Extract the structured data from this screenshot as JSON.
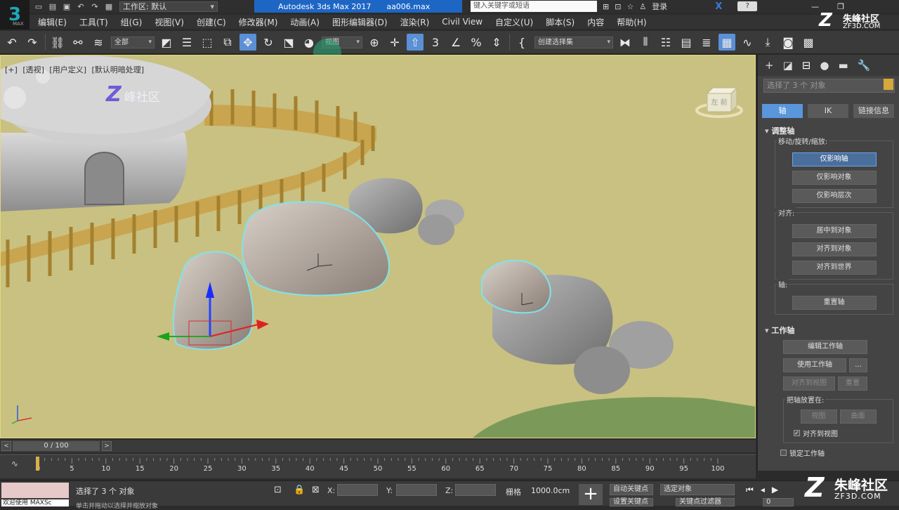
{
  "title_bar": {
    "workspace_label": "工作区: 默认",
    "app_title": "Autodesk 3ds Max 2017",
    "file_name": "aa006.max",
    "search_placeholder": "键入关键字或短语",
    "login_label": "登录",
    "help_label": "?"
  },
  "menu": {
    "items": [
      "编辑(E)",
      "工具(T)",
      "组(G)",
      "视图(V)",
      "创建(C)",
      "修改器(M)",
      "动画(A)",
      "图形编辑器(D)",
      "渲染(R)",
      "Civil View",
      "自定义(U)",
      "脚本(S)",
      "内容",
      "帮助(H)"
    ]
  },
  "toolbar": {
    "selection_filter": "全部",
    "reference_coord": "视图",
    "named_selection": "创建选择集"
  },
  "viewport": {
    "labels": [
      "[+]",
      "[透视]",
      "[用户定义]",
      "[默认明暗处理]"
    ],
    "viewcube_label": "左 前",
    "watermark": "峰社区"
  },
  "command_panel": {
    "selection_text": "选择了 3 个 对象",
    "tabs": [
      "轴",
      "IK",
      "链接信息"
    ],
    "adjust_pivot": {
      "title": "调整轴",
      "move_group_label": "移动/旋转/缩放:",
      "move_buttons": [
        "仅影响轴",
        "仅影响对象",
        "仅影响层次"
      ],
      "align_group_label": "对齐:",
      "align_buttons": [
        "居中到对象",
        "对齐到对象",
        "对齐到世界"
      ],
      "pivot_group_label": "轴:",
      "pivot_buttons": [
        "重置轴"
      ]
    },
    "working_pivot": {
      "title": "工作轴",
      "edit_button": "编辑工作轴",
      "use_button": "使用工作轴",
      "more_button": "...",
      "align_view_button": "对齐到视图",
      "reset_button": "重置",
      "place_group_label": "把轴放置在:",
      "place_buttons": [
        "视图",
        "曲面"
      ],
      "align_to_view_check": "对齐到视图",
      "lock_working_check": "锁定工作轴"
    }
  },
  "timeline": {
    "frame_display": "0 / 100",
    "ticks": [
      0,
      5,
      10,
      15,
      20,
      25,
      30,
      35,
      40,
      45,
      50,
      55,
      60,
      65,
      70,
      75,
      80,
      85,
      90,
      95,
      100
    ]
  },
  "status_bar": {
    "maxscript_text": "欢迎使用 MAXSc",
    "status_text": "选择了 3 个 对象",
    "status_hint": "单击并拖动以选择并缩放对象",
    "x_label": "X:",
    "y_label": "Y:",
    "z_label": "Z:",
    "grid_label": "栅格",
    "grid_value": "1000.0cm",
    "auto_key": "自动关键点",
    "selected_object": "选定对象",
    "set_key": "设置关键点",
    "key_filter": "关键点过滤器",
    "frame_value": "0"
  },
  "watermark": {
    "name": "朱峰社区",
    "url": "ZF3D.COM"
  },
  "colors": {
    "viewport_bg": "#c9c181",
    "active_blue": "#5a96dc",
    "title_blue": "#1e66c4",
    "selection_outline": "#7fe3ec"
  }
}
